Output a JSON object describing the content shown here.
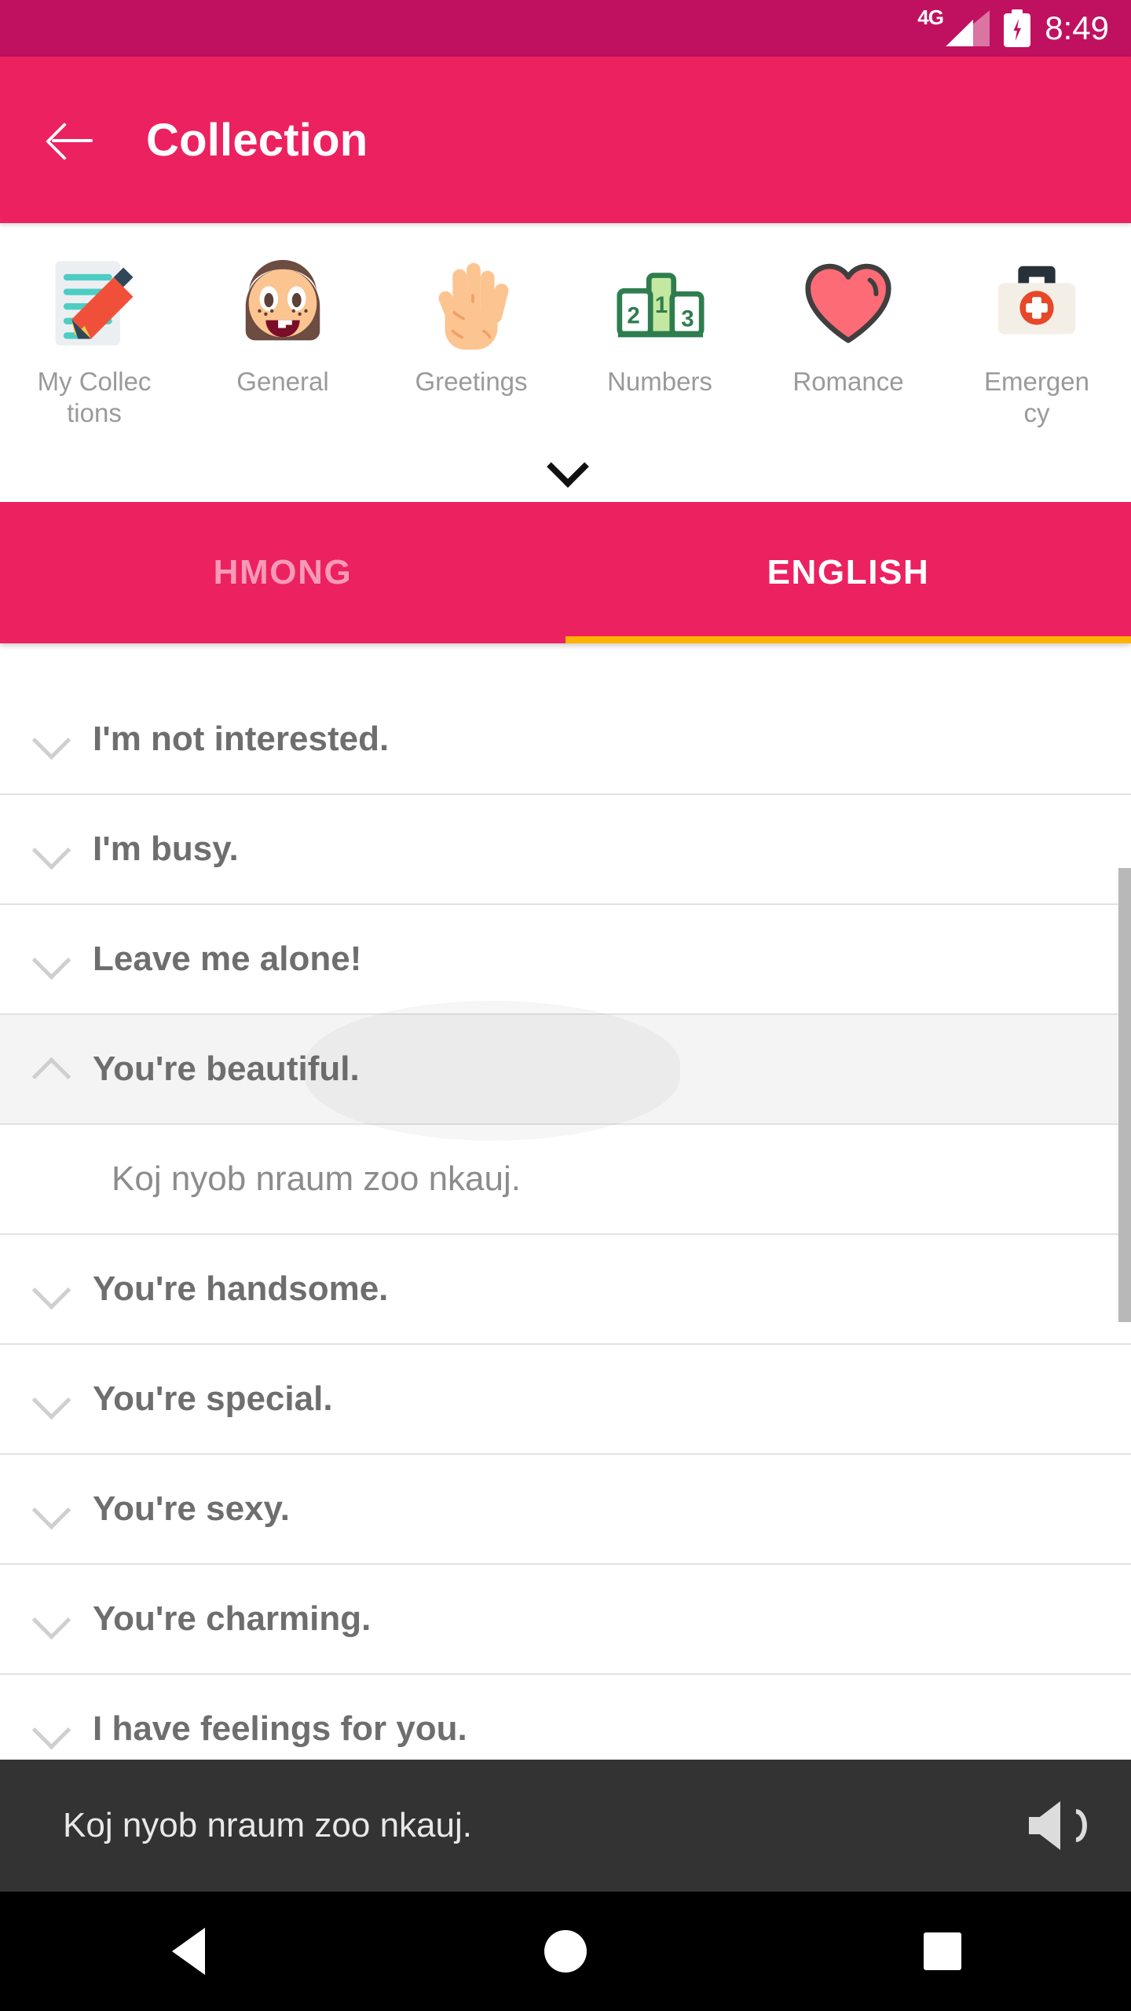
{
  "status_bar": {
    "network": "4G",
    "network_icon": "signal-bars-icon",
    "battery_icon": "battery-charging-icon",
    "time": "8:49",
    "background_color": "#c01160"
  },
  "app_bar": {
    "back_icon": "arrow-left-icon",
    "title": "Collection",
    "background_color": "#ec2160"
  },
  "categories": {
    "expand_icon": "chevron-down-icon",
    "items": [
      {
        "label": "My Collections",
        "icon": "memo-pencil-icon"
      },
      {
        "label": "General",
        "icon": "girl-face-icon"
      },
      {
        "label": "Greetings",
        "icon": "raised-hand-icon"
      },
      {
        "label": "Numbers",
        "icon": "podium-icon"
      },
      {
        "label": "Romance",
        "icon": "heart-icon"
      },
      {
        "label": "Emergency",
        "icon": "first-aid-kit-icon"
      }
    ]
  },
  "tabs": {
    "items": [
      {
        "label": "HMONG",
        "active": false
      },
      {
        "label": "ENGLISH",
        "active": true
      }
    ],
    "indicator_color": "#ffb300"
  },
  "phrase_list": {
    "rows": [
      {
        "text": "I'm not interested.",
        "expanded": false,
        "icon": "chevron-down-icon"
      },
      {
        "text": "I'm busy.",
        "expanded": false,
        "icon": "chevron-down-icon"
      },
      {
        "text": "Leave me alone!",
        "expanded": false,
        "icon": "chevron-down-icon"
      },
      {
        "text": "You're beautiful.",
        "expanded": true,
        "icon": "chevron-up-icon",
        "translation": "Koj nyob nraum zoo nkauj."
      },
      {
        "text": "You're handsome.",
        "expanded": false,
        "icon": "chevron-down-icon"
      },
      {
        "text": "You're special.",
        "expanded": false,
        "icon": "chevron-down-icon"
      },
      {
        "text": "You're sexy.",
        "expanded": false,
        "icon": "chevron-down-icon"
      },
      {
        "text": "You're charming.",
        "expanded": false,
        "icon": "chevron-down-icon"
      },
      {
        "text": "I have feelings for you.",
        "expanded": false,
        "icon": "chevron-down-icon"
      }
    ]
  },
  "player": {
    "text": "Koj nyob nraum zoo nkauj.",
    "speaker_icon": "speaker-volume-icon",
    "background_color": "#333333"
  },
  "nav_bar": {
    "back_icon": "triangle-back-icon",
    "home_icon": "circle-home-icon",
    "recents_icon": "square-recents-icon"
  }
}
